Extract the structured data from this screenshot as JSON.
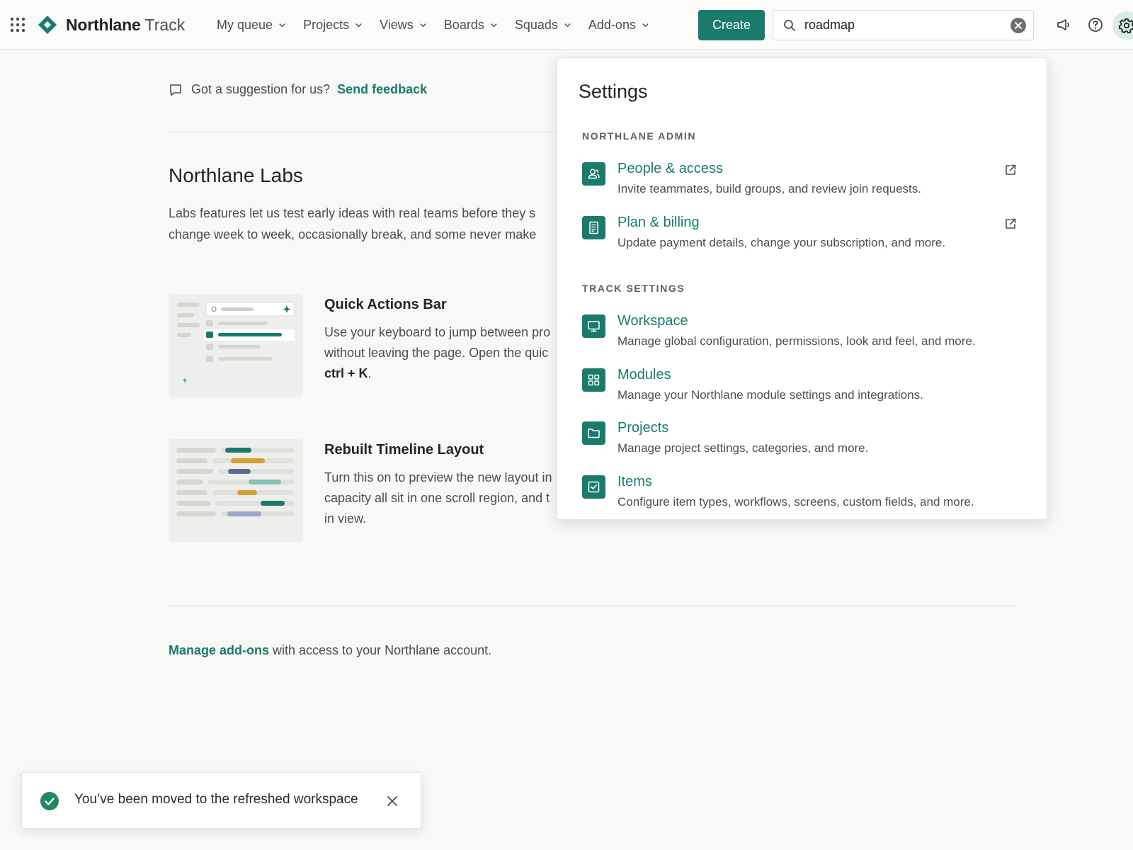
{
  "topbar": {
    "apps_icon": "app-grid-icon",
    "brand_name": "Northlane",
    "brand_suffix": "Track",
    "nav": [
      {
        "label": "My queue"
      },
      {
        "label": "Projects"
      },
      {
        "label": "Views"
      },
      {
        "label": "Boards"
      },
      {
        "label": "Squads"
      },
      {
        "label": "Add-ons"
      }
    ],
    "create_label": "Create",
    "search": {
      "value": "roadmap",
      "placeholder": "Search"
    },
    "icons": [
      "megaphone-icon",
      "help-icon",
      "gear-icon"
    ]
  },
  "colors": {
    "accent": "#1a7a6c",
    "background": "#f8f8f6",
    "success": "#1f8a5b",
    "thumb_teal": "#1a7a6c",
    "thumb_orange": "#d9a030",
    "thumb_slate": "#5c6a94",
    "thumb_mint": "#88bfb4",
    "thumb_lavender": "#9aa8cc"
  },
  "main": {
    "feedback_text": "Got a suggestion for us?",
    "feedback_link": "Send feedback",
    "labs_title": "Northlane Labs",
    "labs_desc_line1": "Labs features let us test early ideas with real teams before they s",
    "labs_desc_line2": "change week to week, occasionally break, and some never make",
    "features": [
      {
        "title": "Quick Actions Bar",
        "line1": "Use your keyboard to jump between pro",
        "line2": "without leaving the page. Open the quic",
        "shortcut": "ctrl + K",
        "shortcut_suffix": "."
      },
      {
        "title": "Rebuilt Timeline Layout",
        "line1": "Turn this on to preview the new layout in",
        "line2": "capacity all sit in one scroll region, and t",
        "line3": "in view."
      }
    ],
    "addons_link": "Manage add-ons",
    "addons_text": " with access to your Northlane account."
  },
  "settings": {
    "title": "Settings",
    "sections": [
      {
        "label": "NORTHLANE ADMIN",
        "items": [
          {
            "title": "People & access",
            "desc": "Invite teammates, build groups, and review join requests.",
            "icon": "people-icon",
            "external": true
          },
          {
            "title": "Plan & billing",
            "desc": "Update payment details, change your subscription, and more.",
            "icon": "receipt-icon",
            "external": true
          }
        ]
      },
      {
        "label": "TRACK SETTINGS",
        "items": [
          {
            "title": "Workspace",
            "desc": "Manage global configuration, permissions, look and feel, and more.",
            "icon": "monitor-icon"
          },
          {
            "title": "Modules",
            "desc": "Manage your Northlane module settings and integrations.",
            "icon": "modules-grid-icon"
          },
          {
            "title": "Projects",
            "desc": "Manage project settings, categories, and more.",
            "icon": "folder-icon"
          },
          {
            "title": "Items",
            "desc": "Configure item types, workflows, screens, custom fields, and more.",
            "icon": "checkbox-icon"
          }
        ]
      }
    ]
  },
  "toast": {
    "text": "You’ve been moved to the refreshed workspace",
    "icon": "success-check-icon"
  }
}
